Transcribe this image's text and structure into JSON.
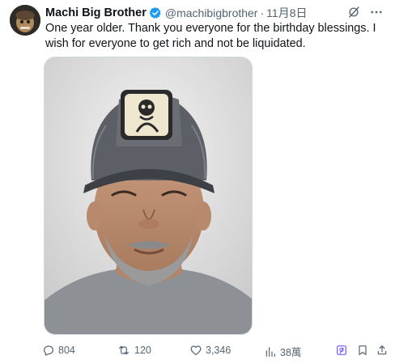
{
  "tweet": {
    "author_name": "Machi Big Brother",
    "handle": "@machibigbrother",
    "separator": "·",
    "date": "11月8日",
    "text": "One year older. Thank you everyone for the birthday blessings. I wish for everyone to get rich and not be liquidated."
  },
  "actions": {
    "replies": "804",
    "reposts": "120",
    "likes": "3,346",
    "views": "38萬"
  },
  "colors": {
    "text_primary": "#0f1419",
    "text_secondary": "#536471",
    "verified_blue": "#1d9bf0",
    "grok_purple": "#7856ff"
  },
  "icons": [
    "avatar",
    "verified-badge-icon",
    "grok-icon",
    "more-icon",
    "reply-icon",
    "repost-icon",
    "like-icon",
    "views-icon",
    "grok-explain-icon",
    "bookmark-icon",
    "share-icon"
  ]
}
